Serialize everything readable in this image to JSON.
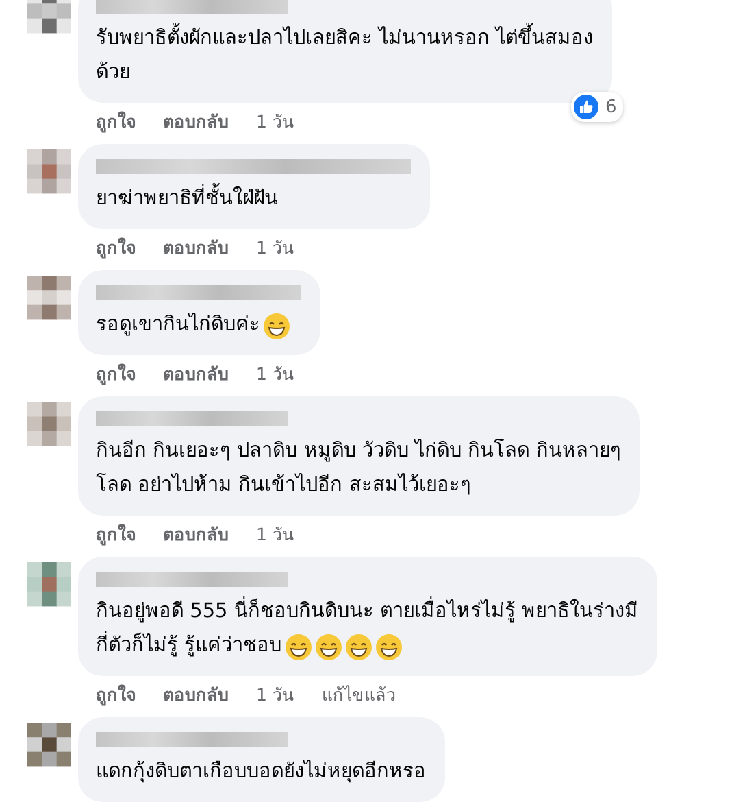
{
  "comments": [
    {
      "lines": [
        "รับพยาธิตั้งผักและปลาไปเลยสิคะ ไม่นานหรอก ไต่ขึ้นสมอง",
        "ด้วย"
      ],
      "reactions": {
        "count": "6"
      },
      "actions": [
        "ถูกใจ",
        "ตอบกลับ",
        "1 วัน"
      ]
    },
    {
      "lines": [
        "ยาฆ่าพยาธิที่ชั้นใฝ่ฝัน"
      ],
      "actions": [
        "ถูกใจ",
        "ตอบกลับ",
        "1 วัน"
      ]
    },
    {
      "lines": [
        "รอดูเขากินไก่ดิบค่ะ"
      ],
      "emojis": [
        {
          "kind": "grin"
        }
      ],
      "actions": [
        "ถูกใจ",
        "ตอบกลับ",
        "1 วัน"
      ]
    },
    {
      "lines": [
        "กินอีก กินเยอะๆ ปลาดิบ หมูดิบ วัวดิบ ไก่ดิบ กินโลด กินหลายๆ",
        "โลด อย่าไปห้าม กินเข้าไปอีก สะสมไว้เยอะๆ"
      ],
      "actions": [
        "ถูกใจ",
        "ตอบกลับ",
        "1 วัน"
      ]
    },
    {
      "lines": [
        "กินอยู่พอดี 555 นี่ก็ชอบกินดิบนะ ตายเมื่อไหร่ไม่รู้ พยาธิในร่างมี",
        "กี่ตัวก็ไม่รู้ รู้แค่ว่าชอบ"
      ],
      "emojis": [
        {
          "kind": "grin"
        },
        {
          "kind": "grin"
        },
        {
          "kind": "grin"
        },
        {
          "kind": "grin"
        }
      ],
      "actions": [
        "ถูกใจ",
        "ตอบกลับ",
        "1 วัน",
        "แก้ไขแล้ว"
      ]
    },
    {
      "lines": [
        "แดกกุ้งดิบตาเกือบบอดยังไม่หยุดอีกหรอ"
      ]
    }
  ]
}
